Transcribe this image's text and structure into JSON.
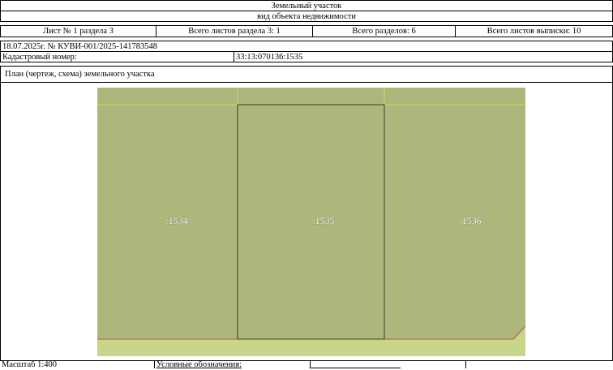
{
  "header": {
    "title": "Земельный участок",
    "subtitle": "вид объекта недвижимости"
  },
  "sheet_info": {
    "sheet": "Лист № 1 раздела 3",
    "total_sheets_section": "Всего листов раздела 3: 1",
    "total_sections": "Всего разделов: 6",
    "total_sheets_extract": "Всего листов выписки: 10"
  },
  "document_ref": "18.07.2025г. № КУВИ-001/2025-141783548",
  "cadastral": {
    "label": "Кадастровый номер:",
    "value": "33:13:070136:1535"
  },
  "plan": {
    "title": "План (чертеж, схема) земельного участка",
    "parcels": [
      {
        "label": ":1534"
      },
      {
        "label": ":1535"
      },
      {
        "label": ":1536"
      }
    ],
    "colors": {
      "parcel_fill": "#adb67b",
      "road_fill": "#c8d68a",
      "neighbor_border": "#dede5e",
      "road_border": "#c0504d",
      "subject_border": "#3c3c28"
    }
  },
  "footer": {
    "scale": "Масштаб 1:400",
    "legend_label": "Условные обозначения:"
  }
}
